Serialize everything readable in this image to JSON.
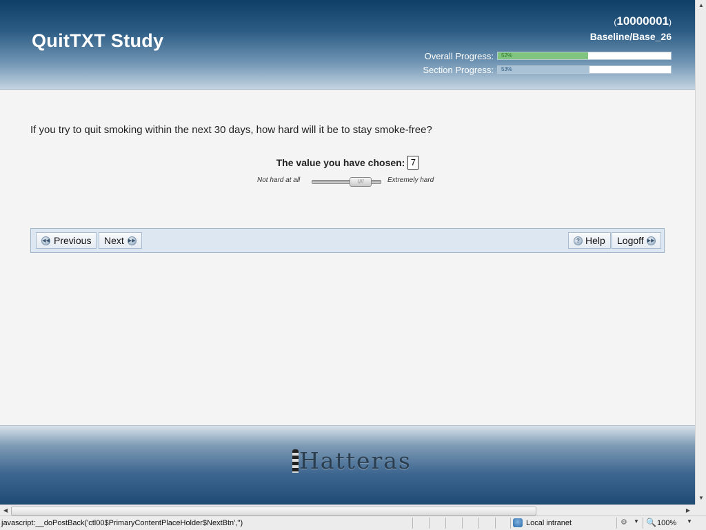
{
  "header": {
    "title": "QuitTXT Study",
    "participant_id": "10000001",
    "paren_open": "(",
    "paren_close": ")",
    "visit": "Baseline/Base_26",
    "overall_progress": {
      "label": "Overall Progress:",
      "value": 52,
      "text": "52%"
    },
    "section_progress": {
      "label": "Section Progress:",
      "value": 53,
      "text": "53%"
    }
  },
  "question": {
    "text": "If you try to quit smoking within the next 30 days, how hard will it be to stay smoke-free?",
    "chosen_label": "The value you have chosen:",
    "chosen_value": "7",
    "slider": {
      "min_label": "Not hard at all",
      "max_label": "Extremely hard",
      "min": 0,
      "max": 10,
      "value": 7
    }
  },
  "nav": {
    "previous_label": "Previous",
    "next_label": "Next",
    "help_label": "Help",
    "logoff_label": "Logoff"
  },
  "footer": {
    "logo_text": "Hatteras"
  },
  "statusbar": {
    "text": "javascript:__doPostBack('ctl00$PrimaryContentPlaceHolder$NextBtn','')",
    "zone": "Local intranet",
    "zoom": "100%"
  },
  "icons": {
    "previous": "rewind-icon",
    "next": "fast-forward-icon",
    "help": "help-icon",
    "logoff": "fast-forward-icon",
    "zone": "globe-icon",
    "zoom": "zoom-icon"
  },
  "colors": {
    "header_dark": "#0f3e66",
    "overall_fill": "#7fc47f",
    "section_fill": "#a9c2d6",
    "navbar_bg": "#dde7f1"
  }
}
